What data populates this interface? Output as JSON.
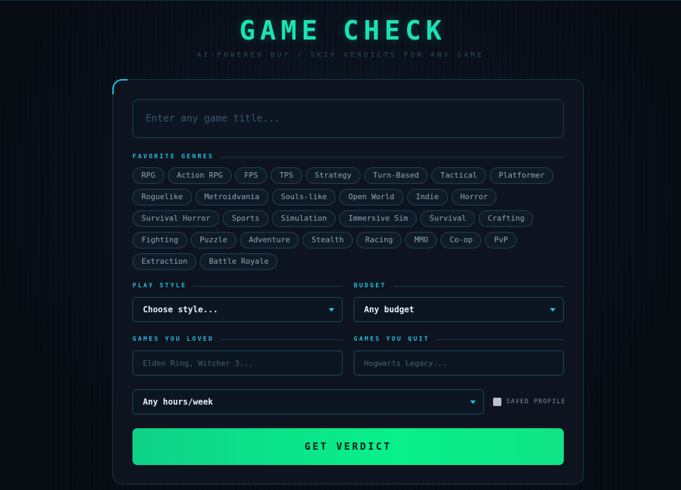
{
  "header": {
    "title": "GAME CHECK",
    "subtitle": "AI-POWERED BUY / SKIP VERDICTS FOR ANY GAME"
  },
  "search": {
    "placeholder": "Enter any game title..."
  },
  "genres": {
    "label": "FAVORITE GENRES",
    "rows": [
      [
        "RPG",
        "Action RPG",
        "FPS",
        "TPS",
        "Strategy",
        "Turn-Based",
        "Tactical",
        "Platformer"
      ],
      [
        "Roguelike",
        "Metroidvania",
        "Souls-like",
        "Open World",
        "Indie",
        "Horror"
      ],
      [
        "Survival Horror",
        "Sports",
        "Simulation",
        "Immersive Sim",
        "Survival",
        "Crafting"
      ],
      [
        "Fighting",
        "Puzzle",
        "Adventure",
        "Stealth",
        "Racing",
        "MMO",
        "Co-op",
        "PvP"
      ],
      [
        "Extraction",
        "Battle Royale"
      ]
    ]
  },
  "play_style": {
    "label": "PLAY STYLE",
    "value": "Choose style..."
  },
  "budget": {
    "label": "BUDGET",
    "value": "Any budget"
  },
  "games_loved": {
    "label": "GAMES YOU LOVED",
    "placeholder": "Elden Ring, Witcher 3..."
  },
  "games_quit": {
    "label": "GAMES YOU QUIT",
    "placeholder": "Hogwarts Legacy..."
  },
  "hours": {
    "value": "Any hours/week"
  },
  "saved_profile": {
    "label": "SAVED PROFILE",
    "checked": false
  },
  "submit": {
    "label": "GET VERDICT"
  },
  "colors": {
    "accent": "#19e3b6",
    "label": "#22bcd9",
    "button": "#08f08a"
  }
}
